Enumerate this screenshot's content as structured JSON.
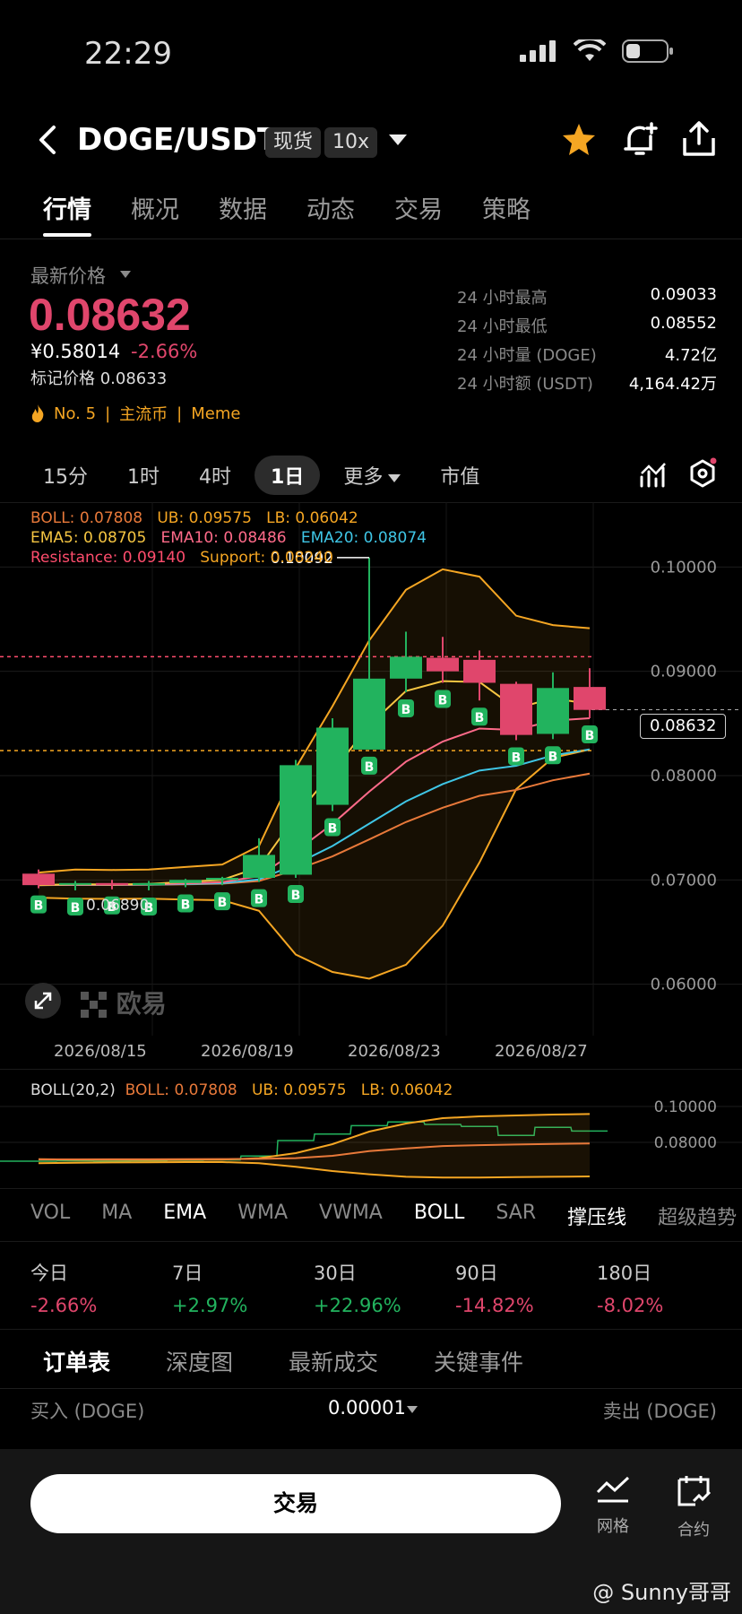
{
  "status": {
    "time": "22:29"
  },
  "header": {
    "pair": "DOGE/USDT",
    "spot_chip": "现货",
    "leverage_chip": "10x"
  },
  "tabs": [
    "行情",
    "概况",
    "数据",
    "动态",
    "交易",
    "策略"
  ],
  "price": {
    "label": "最新价格",
    "last": "0.08632",
    "cny": "¥0.58014",
    "change": "-2.66%",
    "mark": "标记价格 0.08633",
    "tags": [
      "No. 5",
      "主流币",
      "Meme"
    ]
  },
  "stats": [
    {
      "k": "24 小时最高",
      "v": "0.09033"
    },
    {
      "k": "24 小时最低",
      "v": "0.08552"
    },
    {
      "k": "24 小时量 (DOGE)",
      "v": "4.72亿"
    },
    {
      "k": "24 小时额 (USDT)",
      "v": "4,164.42万"
    }
  ],
  "intervals": [
    "15分",
    "1时",
    "4时",
    "1日",
    "更多",
    "市值"
  ],
  "legend": {
    "boll": "BOLL: 0.07808",
    "ub": "UB: 0.09575",
    "lb": "LB: 0.06042",
    "ema5": "EMA5: 0.08705",
    "ema10": "EMA10: 0.08486",
    "ema20": "EMA20: 0.08074",
    "resistance": "Resistance: 0.09140",
    "support": "Support: 0.08240"
  },
  "chart_data": {
    "type": "candlestick",
    "y_ticks": [
      "0.10000",
      "0.09000",
      "0.08000",
      "0.07000",
      "0.06000"
    ],
    "ylim": [
      0.0555,
      0.1045
    ],
    "x_ticks": [
      "2026/08/15",
      "2026/08/19",
      "2026/08/23",
      "2026/08/27"
    ],
    "high_label": "0.10092",
    "low_label": "0.06890",
    "current_price_tag": "0.08632",
    "resistance": 0.0914,
    "support": 0.0824,
    "candles": [
      {
        "o": 0.0706,
        "h": 0.071,
        "l": 0.0692,
        "c": 0.0695
      },
      {
        "o": 0.0696,
        "h": 0.0699,
        "l": 0.069,
        "c": 0.0697
      },
      {
        "o": 0.0697,
        "h": 0.07,
        "l": 0.0691,
        "c": 0.0695
      },
      {
        "o": 0.0695,
        "h": 0.0699,
        "l": 0.069,
        "c": 0.0697
      },
      {
        "o": 0.0697,
        "h": 0.0701,
        "l": 0.0693,
        "c": 0.07
      },
      {
        "o": 0.07,
        "h": 0.0703,
        "l": 0.0695,
        "c": 0.0702
      },
      {
        "o": 0.0702,
        "h": 0.074,
        "l": 0.0698,
        "c": 0.0724
      },
      {
        "o": 0.0705,
        "h": 0.0815,
        "l": 0.0702,
        "c": 0.081
      },
      {
        "o": 0.0772,
        "h": 0.0855,
        "l": 0.0766,
        "c": 0.0846
      },
      {
        "o": 0.0825,
        "h": 0.1009,
        "l": 0.0825,
        "c": 0.0893
      },
      {
        "o": 0.0893,
        "h": 0.0938,
        "l": 0.088,
        "c": 0.0914
      },
      {
        "o": 0.0913,
        "h": 0.0933,
        "l": 0.0889,
        "c": 0.09
      },
      {
        "o": 0.0911,
        "h": 0.092,
        "l": 0.0872,
        "c": 0.0889
      },
      {
        "o": 0.0888,
        "h": 0.089,
        "l": 0.0834,
        "c": 0.0839
      },
      {
        "o": 0.084,
        "h": 0.0899,
        "l": 0.0835,
        "c": 0.0884
      },
      {
        "o": 0.0885,
        "h": 0.0903,
        "l": 0.0855,
        "c": 0.0863
      }
    ],
    "buy_marker": "B"
  },
  "sub_chart": {
    "legend": "BOLL(20,2)",
    "boll": "BOLL: 0.07808",
    "ub": "UB: 0.09575",
    "lb": "LB: 0.06042",
    "y_ticks": [
      "0.10000",
      "0.08000"
    ]
  },
  "indicator_tabs": [
    "VOL",
    "MA",
    "EMA",
    "WMA",
    "VWMA",
    "BOLL",
    "SAR",
    "撑压线",
    "超级趋势"
  ],
  "perf": [
    {
      "k": "今日",
      "v": "-2.66%",
      "dir": "down"
    },
    {
      "k": "7日",
      "v": "+2.97%",
      "dir": "up"
    },
    {
      "k": "30日",
      "v": "+22.96%",
      "dir": "up"
    },
    {
      "k": "90日",
      "v": "-14.82%",
      "dir": "down"
    },
    {
      "k": "180日",
      "v": "-8.02%",
      "dir": "down"
    }
  ],
  "orderbook": {
    "tabs": [
      "订单表",
      "深度图",
      "最新成交",
      "关键事件"
    ],
    "buy_label": "买入 (DOGE)",
    "tick": "0.00001",
    "sell_label": "卖出 (DOGE)"
  },
  "bottom": {
    "trade": "交易",
    "grid": "网格",
    "contract": "合约"
  },
  "watermark": "欧易",
  "credit": "@ Sunny哥哥",
  "colors": {
    "up": "#22b35e",
    "down": "#e0466c",
    "accent": "#f5a623"
  }
}
